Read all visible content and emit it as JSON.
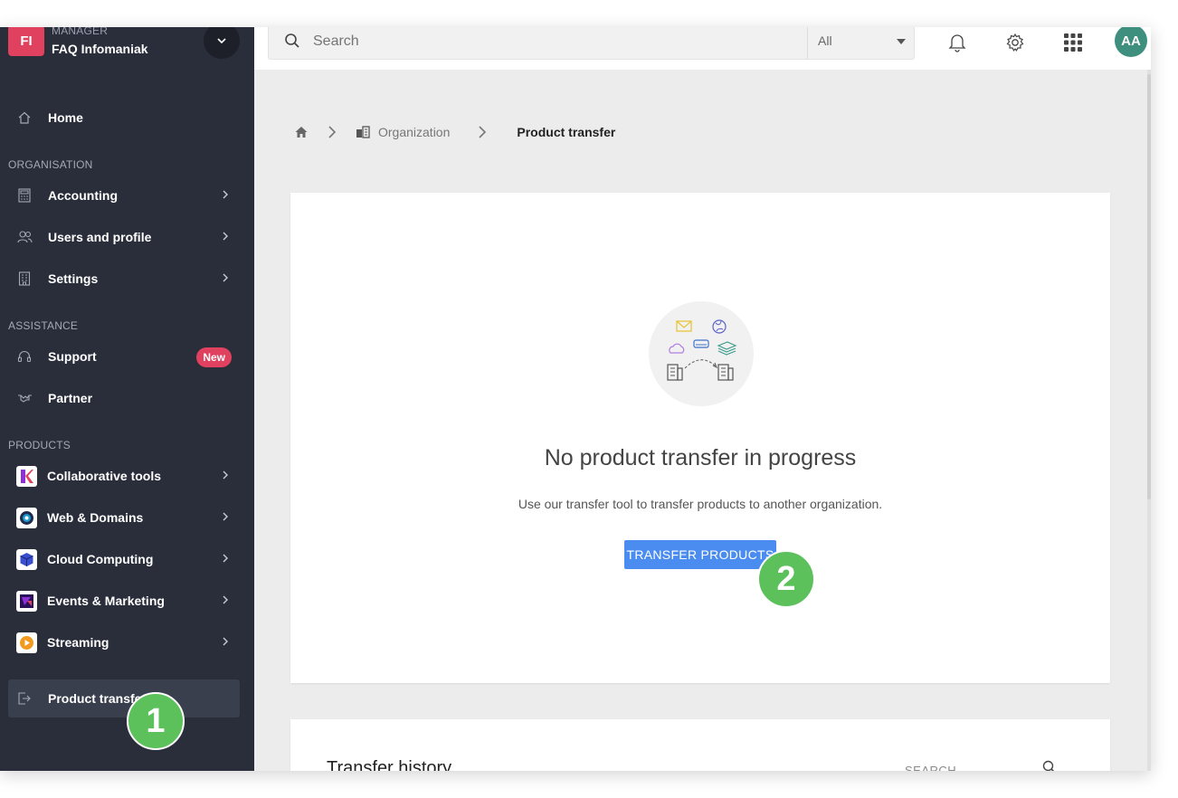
{
  "org": {
    "initials": "FI",
    "role": "MANAGER",
    "name": "FAQ Infomaniak"
  },
  "sidebar": {
    "home": "Home",
    "sections": {
      "organisation": "ORGANISATION",
      "assistance": "ASSISTANCE",
      "products": "PRODUCTS"
    },
    "organisation_items": [
      {
        "label": "Accounting",
        "icon": "calculator-icon"
      },
      {
        "label": "Users and profile",
        "icon": "users-icon"
      },
      {
        "label": "Settings",
        "icon": "building-icon"
      }
    ],
    "assistance_items": [
      {
        "label": "Support",
        "icon": "headset-icon",
        "badge": "New"
      },
      {
        "label": "Partner",
        "icon": "handshake-icon"
      }
    ],
    "product_items": [
      {
        "label": "Collaborative tools",
        "icon": "kchat-logo-icon",
        "color": "#e0415f"
      },
      {
        "label": "Web & Domains",
        "icon": "web-logo-icon",
        "color": "#1d9bd1"
      },
      {
        "label": "Cloud Computing",
        "icon": "cube-logo-icon",
        "color": "#3a4fd0"
      },
      {
        "label": "Events & Marketing",
        "icon": "events-logo-icon",
        "color": "#8c2fd6"
      },
      {
        "label": "Streaming",
        "icon": "play-logo-icon",
        "color": "#f29a1f"
      }
    ],
    "active_item": "Product transfer"
  },
  "topbar": {
    "search_placeholder": "Search",
    "filter": "All",
    "avatar": "AA"
  },
  "breadcrumb": {
    "org": "Organization",
    "current": "Product transfer"
  },
  "empty_state": {
    "title": "No product transfer in progress",
    "description": "Use our transfer tool to transfer products to another organization.",
    "button": "TRANSFER PRODUCTS"
  },
  "history": {
    "title": "Transfer history",
    "search_label": "SEARCH"
  },
  "steps": {
    "one": "1",
    "two": "2"
  },
  "colors": {
    "sidebar_bg": "#2a2e3b",
    "accent_red": "#e0415f",
    "button_blue": "#4b8cf0",
    "step_green": "#5cc15a",
    "avatar_teal": "#3f8f7e"
  }
}
